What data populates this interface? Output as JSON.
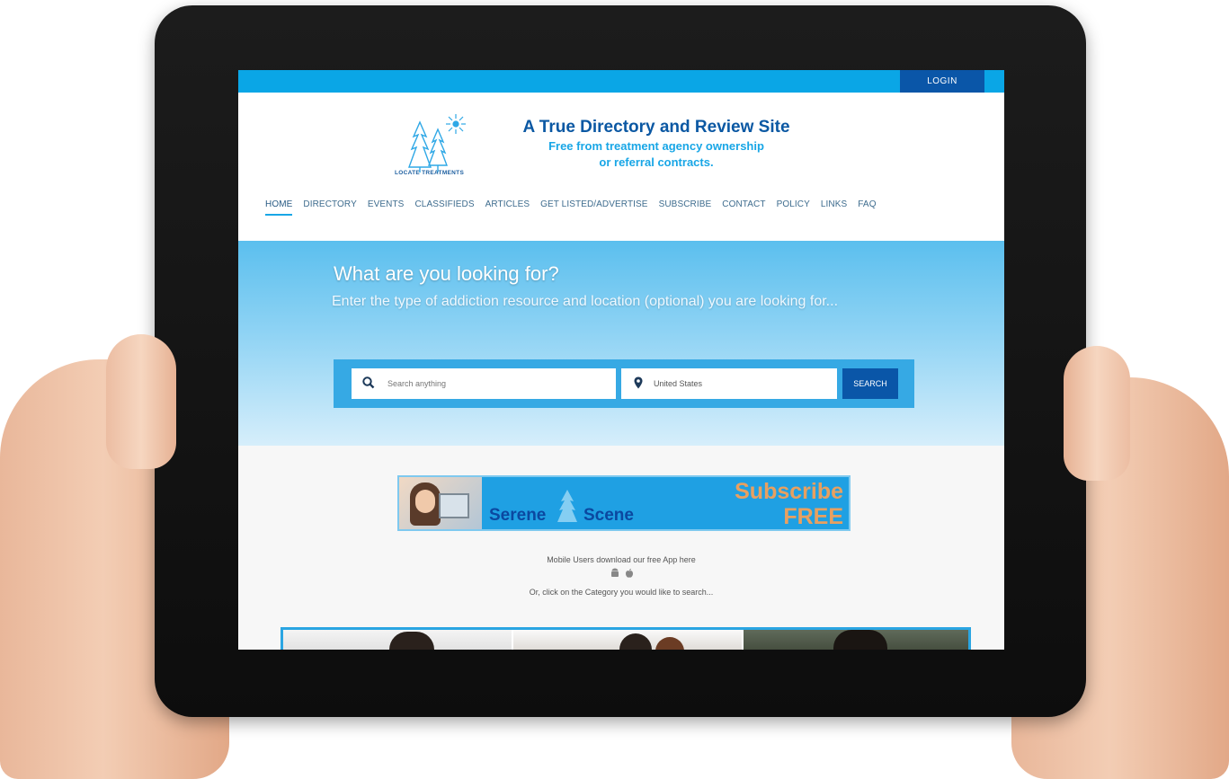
{
  "topbar": {
    "login_label": "LOGIN"
  },
  "brand": {
    "logo_text": "LOCATE TREATMENTS",
    "title": "A True Directory and Review Site",
    "subtitle_line1": "Free from treatment agency ownership",
    "subtitle_line2": "or referral contracts."
  },
  "nav": {
    "items": [
      {
        "label": "HOME",
        "active": true
      },
      {
        "label": "DIRECTORY"
      },
      {
        "label": "EVENTS"
      },
      {
        "label": "CLASSIFIEDS"
      },
      {
        "label": "ARTICLES"
      },
      {
        "label": "GET LISTED/ADVERTISE"
      },
      {
        "label": "SUBSCRIBE"
      },
      {
        "label": "CONTACT"
      },
      {
        "label": "POLICY"
      },
      {
        "label": "LINKS"
      },
      {
        "label": "FAQ"
      }
    ]
  },
  "hero": {
    "title": "What are you looking for?",
    "subtitle": "Enter the type of addiction resource and location (optional) you are looking for..."
  },
  "search": {
    "placeholder": "Search anything",
    "location_value": "United States",
    "button_label": "SEARCH",
    "search_icon": "search-icon",
    "location_icon": "map-pin-icon"
  },
  "banner": {
    "brand_left": "Serene",
    "brand_right": "Scene",
    "cta_line1": "Subscribe",
    "cta_line2": "FREE"
  },
  "mobile": {
    "download_text": "Mobile Users download our free App here",
    "icons": [
      "android-icon",
      "apple-icon"
    ],
    "category_prompt": "Or, click on the Category you would like to search..."
  },
  "colors": {
    "accent": "#0aa6e6",
    "dark_blue": "#0a56a8",
    "banner_orange": "#e8a060"
  }
}
